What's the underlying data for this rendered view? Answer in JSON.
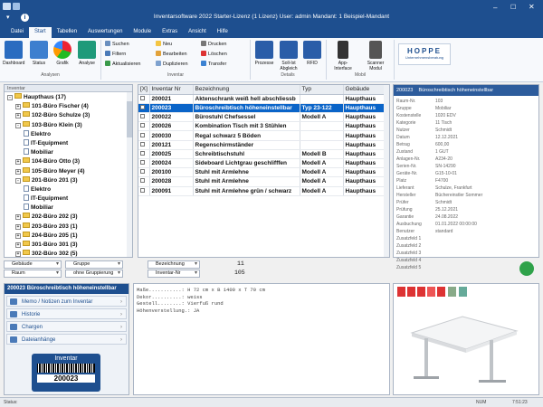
{
  "title": "Inventarsoftware 2022 Starter-Lizenz (1 Lizenz)   User: admin   Mandant: 1 Beispiel-Mandant",
  "menu": [
    "Datei",
    "Start",
    "Tabellen",
    "Auswertungen",
    "Module",
    "Extras",
    "Ansicht",
    "Hilfe"
  ],
  "ribbon": {
    "analysen_label": "Analysen",
    "inventar_label": "Inventar",
    "details_label": "Details",
    "mobil_label": "Mobil",
    "dashboard": "Dashboard",
    "status": "Status",
    "grafik": "Grafik",
    "analyse": "Analyse",
    "suchen": "Suchen",
    "filtern": "Filtern",
    "aktualisieren": "Aktualisieren",
    "neu": "Neu",
    "bearbeiten": "Bearbeiten",
    "duplizieren": "Duplizieren",
    "drucken": "Drucken",
    "loeschen": "Löschen",
    "transfer": "Transfer",
    "prozesse": "Prozesse",
    "soll_ist": "Soll-Ist Abgleich",
    "rfid": "RFID",
    "app": "App-Interface",
    "scanner": "Scanner Modul",
    "logo": "HOPPE",
    "logo_sub": "Unternehmensberatung"
  },
  "tree": {
    "header": "Inventar",
    "items": [
      {
        "level": 0,
        "type": "folder",
        "exp": "-",
        "label": "Haupthaus  (17)"
      },
      {
        "level": 1,
        "type": "folder",
        "exp": "+",
        "label": "101-Büro Fischer  (4)"
      },
      {
        "level": 1,
        "type": "folder",
        "exp": "+",
        "label": "102-Büro Schulze  (3)"
      },
      {
        "level": 1,
        "type": "folder",
        "exp": "-",
        "label": "103-Büro Klein  (3)"
      },
      {
        "level": 2,
        "type": "file",
        "exp": "",
        "label": "Elektro"
      },
      {
        "level": 2,
        "type": "file",
        "exp": "",
        "label": "IT-Equipment"
      },
      {
        "level": 2,
        "type": "file",
        "exp": "",
        "label": "Mobiliar"
      },
      {
        "level": 1,
        "type": "folder",
        "exp": "+",
        "label": "104-Büro  Otto  (3)"
      },
      {
        "level": 1,
        "type": "folder",
        "exp": "+",
        "label": "105-Büro  Meyer  (4)"
      },
      {
        "level": 1,
        "type": "folder",
        "exp": "-",
        "label": "201-Büro 201  (3)"
      },
      {
        "level": 2,
        "type": "file",
        "exp": "",
        "label": "Elektro"
      },
      {
        "level": 2,
        "type": "file",
        "exp": "",
        "label": "IT-Equipment"
      },
      {
        "level": 2,
        "type": "file",
        "exp": "",
        "label": "Mobiliar"
      },
      {
        "level": 1,
        "type": "folder",
        "exp": "+",
        "label": "202-Büro 202  (3)"
      },
      {
        "level": 1,
        "type": "folder",
        "exp": "+",
        "label": "203-Büro 203  (1)"
      },
      {
        "level": 1,
        "type": "folder",
        "exp": "+",
        "label": "204-Büro 205  (1)"
      },
      {
        "level": 1,
        "type": "folder",
        "exp": "+",
        "label": "301-Büro 301  (3)"
      },
      {
        "level": 1,
        "type": "folder",
        "exp": "+",
        "label": "302-Büro 302  (5)"
      }
    ]
  },
  "grid": {
    "headers": [
      "[X]",
      "Inventar Nr",
      "Bezeichnung",
      "Typ",
      "Gebäude"
    ],
    "rows": [
      {
        "nr": "200021",
        "bez": "Aktenschrank weiß hell abschliessb",
        "typ": "",
        "geb": "Haupthaus",
        "sel": false
      },
      {
        "nr": "200023",
        "bez": "Büroschreibtisch höheneinstellbar",
        "typ": "Typ 23-122",
        "geb": "Haupthaus",
        "sel": true
      },
      {
        "nr": "200022",
        "bez": "Bürostuhl Chefsessel",
        "typ": "Modell A",
        "geb": "Haupthaus",
        "sel": false
      },
      {
        "nr": "200026",
        "bez": "Kombination Tisch mit 3 Stühlen",
        "typ": "",
        "geb": "Haupthaus",
        "sel": false
      },
      {
        "nr": "200030",
        "bez": "Regal schwarz 5 Böden",
        "typ": "",
        "geb": "Haupthaus",
        "sel": false
      },
      {
        "nr": "200121",
        "bez": "Regenschirmständer",
        "typ": "",
        "geb": "Haupthaus",
        "sel": false
      },
      {
        "nr": "200025",
        "bez": "Schreibtischstuhl",
        "typ": "Modell B",
        "geb": "Haupthaus",
        "sel": false
      },
      {
        "nr": "200024",
        "bez": "Sideboard Lichtgrau geschlifffen",
        "typ": "Modell A",
        "geb": "Haupthaus",
        "sel": false
      },
      {
        "nr": "200100",
        "bez": "Stuhl mit Armlehne",
        "typ": "Modell A",
        "geb": "Haupthaus",
        "sel": false
      },
      {
        "nr": "200028",
        "bez": "Stuhl mit Armlehne",
        "typ": "Modell A",
        "geb": "Haupthaus",
        "sel": false
      },
      {
        "nr": "200091",
        "bez": "Stuhl mit Armlehne grün / schwarz",
        "typ": "Modell A",
        "geb": "Haupthaus",
        "sel": false
      }
    ]
  },
  "details": {
    "nr": "200023",
    "title": "Büroschreibtisch höheneinstellbar",
    "fields": [
      {
        "k": "Raum-Nr.",
        "v": "103"
      },
      {
        "k": "Gruppe",
        "v": "Mobiliar"
      },
      {
        "k": "Kostenstelle",
        "v": "1020 EDV"
      },
      {
        "k": "Kategorie",
        "v": "11 Tisch"
      },
      {
        "k": "Nutzer",
        "v": "Schmidt"
      },
      {
        "k": "Datum",
        "v": "12.12.2021"
      },
      {
        "k": "Betrag",
        "v": "600,00"
      },
      {
        "k": "Zustand",
        "v": "1 GUT"
      },
      {
        "k": "Anlagen-Nr.",
        "v": "A234-20"
      },
      {
        "k": "Serien-Nr.",
        "v": "SN-14290"
      },
      {
        "k": "Geräte-Nr.",
        "v": "G15-10-01"
      },
      {
        "k": "Platz",
        "v": "F4700"
      },
      {
        "k": "Lieferant",
        "v": "Schulze, Frankfurt"
      },
      {
        "k": "Hersteller",
        "v": "Büchereinstler Sommer"
      },
      {
        "k": "Prüfer",
        "v": "Schmidt"
      },
      {
        "k": "Prüfung",
        "v": "25.12.2021"
      },
      {
        "k": "Garantie",
        "v": "24.08.2022"
      },
      {
        "k": "Ausbuchung",
        "v": "01.01.2022 00:00:00"
      },
      {
        "k": "Benutzer",
        "v": "standard"
      },
      {
        "k": "Zusatzfeld 1",
        "v": ""
      },
      {
        "k": "Zusatzfeld 2",
        "v": ""
      },
      {
        "k": "Zusatzfeld 3",
        "v": ""
      },
      {
        "k": "Zusatzfeld 4",
        "v": ""
      },
      {
        "k": "Zusatzfeld 5",
        "v": ""
      }
    ]
  },
  "filters": {
    "g1": "Gebäude",
    "g2": "Gruppe",
    "g3": "Raum",
    "g4": "ohne Gruppierung",
    "s1": "Bezeichnung",
    "s2": "Inventar-Nr",
    "count1": "11",
    "count2": "105"
  },
  "bottom": {
    "header": "200023 Büroschreibtisch höheneinstellbar",
    "tabs": [
      "Memo / Notizen zum Inventar",
      "Historie",
      "Chargen",
      "Dateianhänge"
    ],
    "label_title": "Inventar",
    "label_code": "200023",
    "memo": [
      "Maße...........: H 72 cm x B 1400 x T 70 cm",
      "Dekor..........: weiss",
      "Gestell........: Vierfuß rund",
      "Höhenverstellung.: JA"
    ]
  },
  "status": {
    "left": "Status:",
    "num": "NUM",
    "time": "7:51:23"
  }
}
